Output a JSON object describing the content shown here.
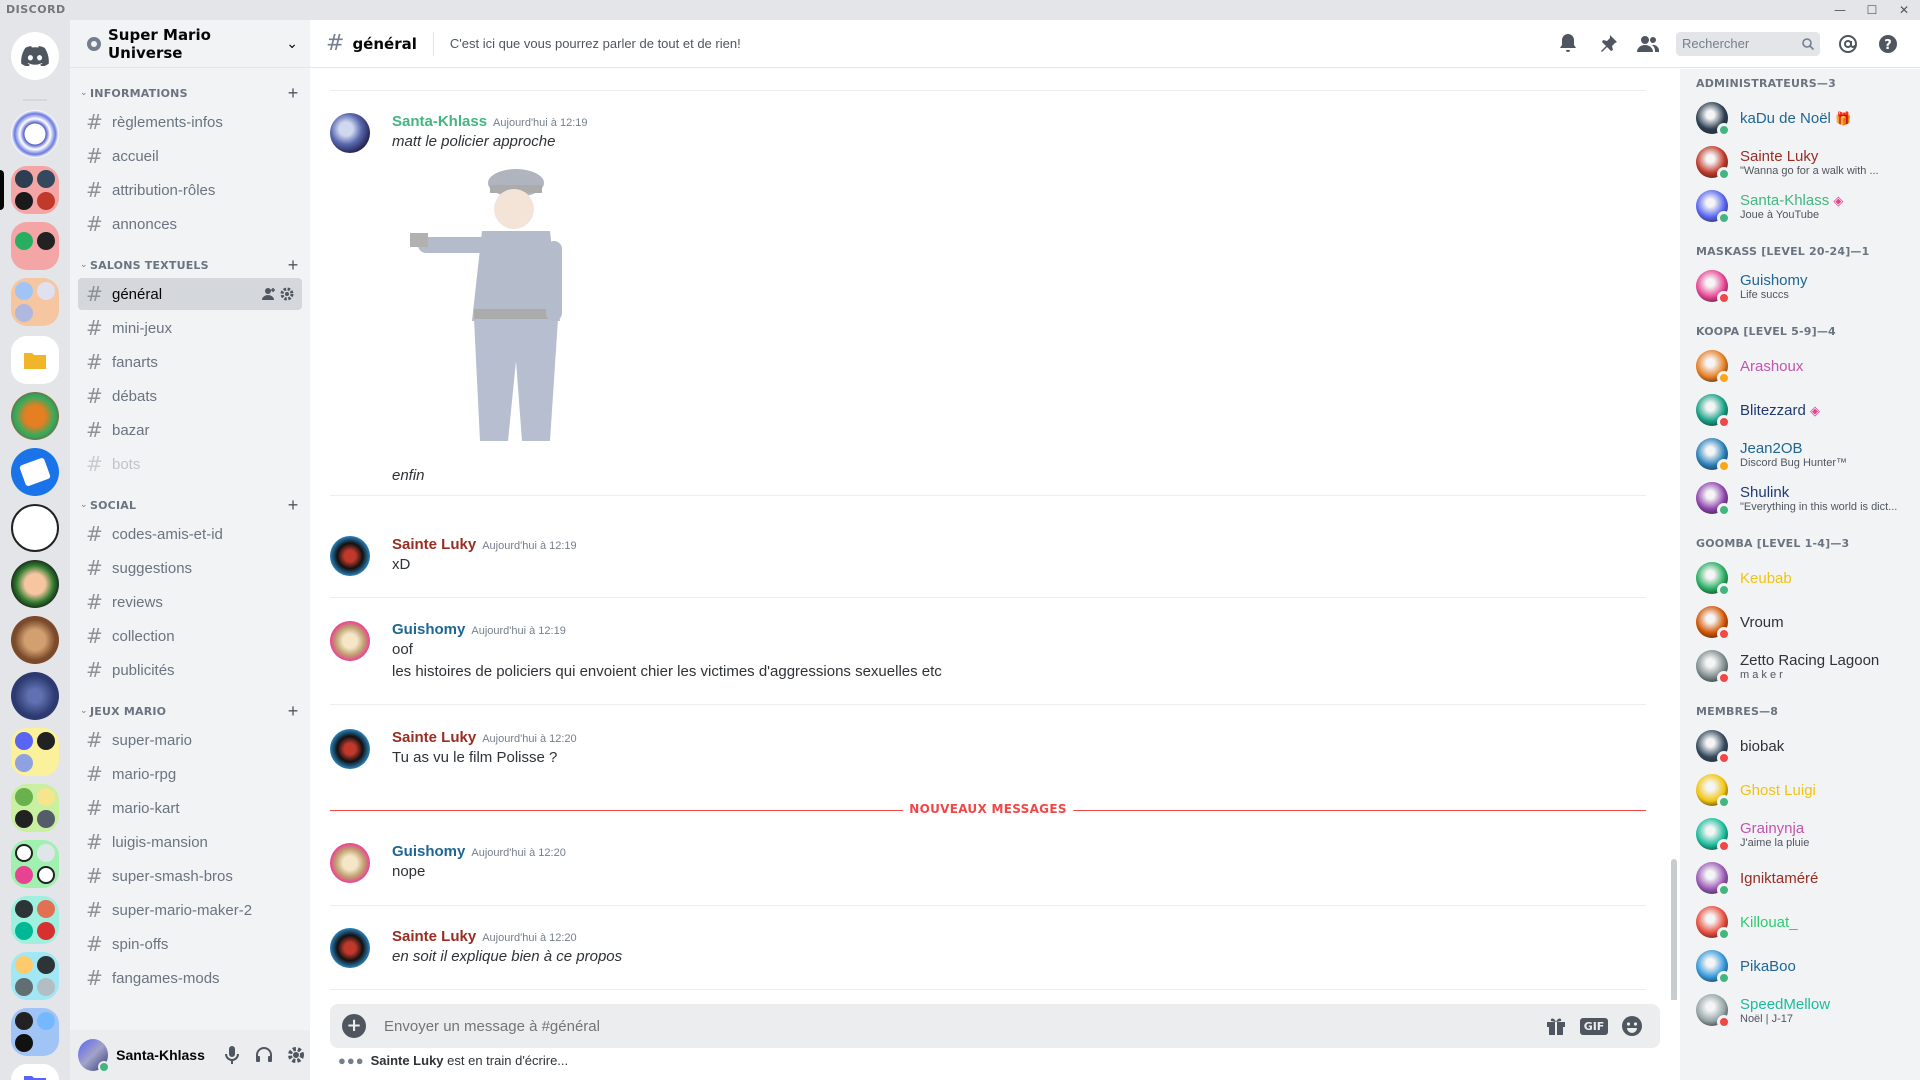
{
  "window": {
    "logo": "DISCORD",
    "controls": [
      "—",
      "☐",
      "✕"
    ]
  },
  "server": {
    "name": "Super Mario Universe"
  },
  "categories": [
    {
      "name": "INFORMATIONS",
      "channels": [
        {
          "name": "règlements-infos"
        },
        {
          "name": "accueil"
        },
        {
          "name": "attribution-rôles"
        },
        {
          "name": "annonces"
        }
      ]
    },
    {
      "name": "SALONS TEXTUELS",
      "channels": [
        {
          "name": "général"
        },
        {
          "name": "mini-jeux"
        },
        {
          "name": "fanarts"
        },
        {
          "name": "débats"
        },
        {
          "name": "bazar"
        },
        {
          "name": "bots"
        }
      ]
    },
    {
      "name": "SOCIAL",
      "channels": [
        {
          "name": "codes-amis-et-id"
        },
        {
          "name": "suggestions"
        },
        {
          "name": "reviews"
        },
        {
          "name": "collection"
        },
        {
          "name": "publicités"
        }
      ]
    },
    {
      "name": "JEUX MARIO",
      "channels": [
        {
          "name": "super-mario"
        },
        {
          "name": "mario-rpg"
        },
        {
          "name": "mario-kart"
        },
        {
          "name": "luigis-mansion"
        },
        {
          "name": "super-smash-bros"
        },
        {
          "name": "super-mario-maker-2"
        },
        {
          "name": "spin-offs"
        },
        {
          "name": "fangames-mods"
        }
      ]
    }
  ],
  "user": {
    "name": "Santa-Khlass"
  },
  "header": {
    "channel": "général",
    "topic": "C'est ici que vous pourrez parler de tout et de rien!",
    "search_placeholder": "Rechercher"
  },
  "messages": [
    {
      "author": "Santa-Khlass",
      "color": "#43b581",
      "time": "Aujourd'hui à 12:19",
      "lines": [
        "matt le policier approche"
      ],
      "italic": true,
      "caption": "enfin"
    },
    {
      "author": "Sainte Luky",
      "color": "#992d22",
      "time": "Aujourd'hui à 12:19",
      "lines": [
        "xD"
      ],
      "italic": false
    },
    {
      "author": "Guishomy",
      "color": "#206694",
      "time": "Aujourd'hui à 12:19",
      "lines": [
        "oof",
        "les histoires de policiers qui envoient chier les victimes d'aggressions sexuelles etc"
      ],
      "italic": false
    },
    {
      "author": "Sainte Luky",
      "color": "#992d22",
      "time": "Aujourd'hui à 12:20",
      "lines": [
        "Tu as vu le film Polisse ?"
      ],
      "italic": false
    },
    {
      "author": "Guishomy",
      "color": "#206694",
      "time": "Aujourd'hui à 12:20",
      "lines": [
        "nope"
      ],
      "italic": false
    },
    {
      "author": "Sainte Luky",
      "color": "#992d22",
      "time": "Aujourd'hui à 12:20",
      "lines": [
        "en soit il explique bien à ce propos"
      ],
      "italic": true
    }
  ],
  "new_messages_label": "NOUVEAUX MESSAGES",
  "composer": {
    "placeholder": "Envoyer un message à #général",
    "gif": "GIF"
  },
  "typing": {
    "user": "Sainte Luky",
    "text": "est en train d'écrire..."
  },
  "member_groups": [
    {
      "title": "ADMINISTRATEURS—3",
      "members": [
        {
          "name": "kaDu de Noël",
          "color": "#206694",
          "sub": "",
          "status": "#43b581",
          "badge": "🎁"
        },
        {
          "name": "Sainte Luky",
          "color": "#992d22",
          "sub": "\"Wanna go for a walk with ...",
          "status": "#43b581"
        },
        {
          "name": "Santa-Khlass",
          "color": "#43b581",
          "sub": "Joue à YouTube",
          "sub_bold": "YouTube",
          "status": "#43b581",
          "badge": "◈"
        }
      ]
    },
    {
      "title": "MASKASS [LEVEL 20-24]—1",
      "members": [
        {
          "name": "Guishomy",
          "color": "#206694",
          "sub": "Life succs",
          "status": "#f04747"
        }
      ]
    },
    {
      "title": "KOOPA [LEVEL 5-9]—4",
      "members": [
        {
          "name": "Arashoux",
          "color": "#c354ae",
          "sub": "",
          "status": "#faa61a"
        },
        {
          "name": "Blitezzard",
          "color": "#1f3a73",
          "sub": "",
          "status": "#f04747",
          "badge": "◈"
        },
        {
          "name": "Jean2OB",
          "color": "#206694",
          "sub": "Discord Bug Hunter™",
          "status": "#faa61a"
        },
        {
          "name": "Shulink",
          "color": "#1f3a73",
          "sub": "\"Everything in this world is dict...",
          "status": "#43b581"
        }
      ]
    },
    {
      "title": "GOOMBA [LEVEL 1-4]—3",
      "members": [
        {
          "name": "Keubab",
          "color": "#f1c40f",
          "sub": "",
          "status": "#43b581"
        },
        {
          "name": "Vroum",
          "color": "#2e3338",
          "sub": "",
          "status": "#f04747"
        },
        {
          "name": "Zetto Racing Lagoon",
          "color": "#2e3338",
          "sub": "m a k e r",
          "status": "#f04747"
        }
      ]
    },
    {
      "title": "MEMBRES—8",
      "members": [
        {
          "name": "biobak",
          "color": "#2e3338",
          "sub": "",
          "status": "#f04747"
        },
        {
          "name": "Ghost Luigi",
          "color": "#f1c40f",
          "sub": "",
          "status": "#43b581"
        },
        {
          "name": "Grainynja",
          "color": "#c354ae",
          "sub": "J'aime la pluie",
          "status": "#f04747"
        },
        {
          "name": "Igniktaméré",
          "color": "#992d22",
          "sub": "",
          "status": "#43b581"
        },
        {
          "name": "Killouat_",
          "color": "#2ecc71",
          "sub": "",
          "status": "#43b581"
        },
        {
          "name": "PikaBoo",
          "color": "#206694",
          "sub": "",
          "status": "#43b581"
        },
        {
          "name": "SpeedMellow",
          "color": "#1abc9c",
          "sub": "Noël | J-17",
          "status": "#f04747"
        }
      ]
    }
  ]
}
